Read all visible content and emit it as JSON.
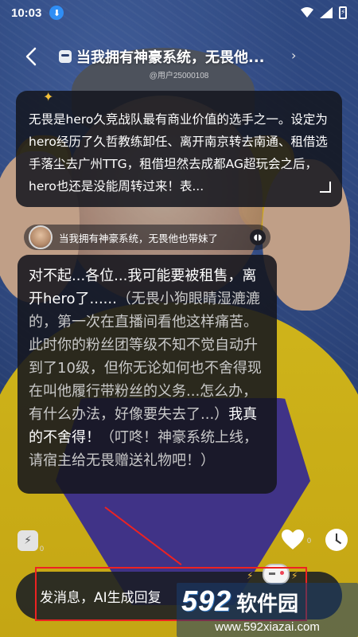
{
  "status_bar": {
    "time": "10:03",
    "battery_glyph": "⚡"
  },
  "header": {
    "title": "当我拥有神豪系统，无畏他...",
    "user_id": "@用户25000108"
  },
  "intro": {
    "text": "无畏是hero久竞战队最有商业价值的选手之一。设定为hero经历了久哲教练卸任、离开南京转去南通、租借选手落尘去广州TTG，租借坦然去成都AG超玩会之后，hero也还是没能周转过来！表..."
  },
  "chat": {
    "name": "当我拥有神豪系统，无畏他也带妹了"
  },
  "message": {
    "part1": "对不起...各位...我可能要被租售，离开hero了......",
    "part2": "（无畏小狗眼睛湿漉漉的，第一次在直播间看他这样痛苦。此时你的粉丝团等级不知不觉自动升到了10级，但你无论如何也不舍得现在叫他履行带粉丝的义务...怎么办，有什么办法，好像要失去了...）",
    "part3": "我真的不舍得！",
    "part4": "（叮咚！神豪系统上线，请宿主给无畏赠送礼物吧！）"
  },
  "actions": {
    "energy_count": "0",
    "likes_count": "0"
  },
  "input": {
    "placeholder": "发消息，AI生成回复"
  },
  "watermark": {
    "number": "592",
    "name": "软件园",
    "url": "www.592xiazai.com"
  },
  "colors": {
    "accent_red": "#e22222",
    "sparkle": "#f3c03a",
    "download_badge": "#2f8ef5"
  },
  "icons": {
    "back": "chevron-left-icon",
    "title": "robot-icon",
    "more": "chevron-right-icon",
    "intro": "sparkle-icon",
    "expand": "expand-icon",
    "voice": "sound-wave-icon",
    "energy": "bolt-icon",
    "like": "heart-icon",
    "history": "clock-icon",
    "game": "gamepad-icon"
  }
}
